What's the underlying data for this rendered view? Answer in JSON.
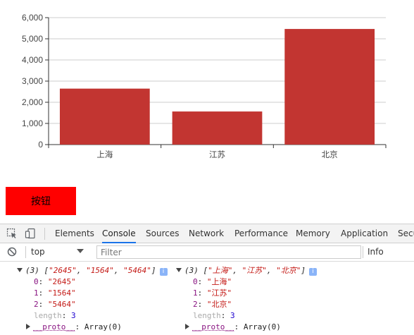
{
  "chart_data": {
    "type": "bar",
    "categories": [
      "上海",
      "江苏",
      "北京"
    ],
    "values": [
      2645,
      1564,
      5464
    ],
    "ylim": [
      0,
      6000
    ],
    "yticks": [
      "0",
      "1,000",
      "2,000",
      "3,000",
      "4,000",
      "5,000",
      "6,000"
    ],
    "grid": true,
    "bar_color": "#c23531"
  },
  "button": {
    "label": "按钮",
    "color": "#ff0000"
  },
  "devtools": {
    "tabs": [
      "Elements",
      "Console",
      "Sources",
      "Network",
      "Performance",
      "Memory",
      "Application",
      "Secu"
    ],
    "active_tab": "Console",
    "context": "top",
    "filter_placeholder": "Filter",
    "levels_label": "Info"
  },
  "console": {
    "entries": [
      {
        "summary_prefix": "(3) [",
        "summary_items": [
          "\"2645\"",
          "\"1564\"",
          "\"5464\""
        ],
        "summary_suffix": "]",
        "items": [
          {
            "key": "0",
            "value": "\"2645\""
          },
          {
            "key": "1",
            "value": "\"1564\""
          },
          {
            "key": "2",
            "value": "\"5464\""
          }
        ],
        "length_key": "length",
        "length_value": "3",
        "proto_key": "__proto__",
        "proto_value": "Array(0)"
      },
      {
        "summary_prefix": "(3) [",
        "summary_items": [
          "\"上海\"",
          "\"江苏\"",
          "\"北京\""
        ],
        "summary_suffix": "]",
        "items": [
          {
            "key": "0",
            "value": "\"上海\""
          },
          {
            "key": "1",
            "value": "\"江苏\""
          },
          {
            "key": "2",
            "value": "\"北京\""
          }
        ],
        "length_key": "length",
        "length_value": "3",
        "proto_key": "__proto__",
        "proto_value": "Array(0)"
      }
    ],
    "info_badge": "i"
  }
}
